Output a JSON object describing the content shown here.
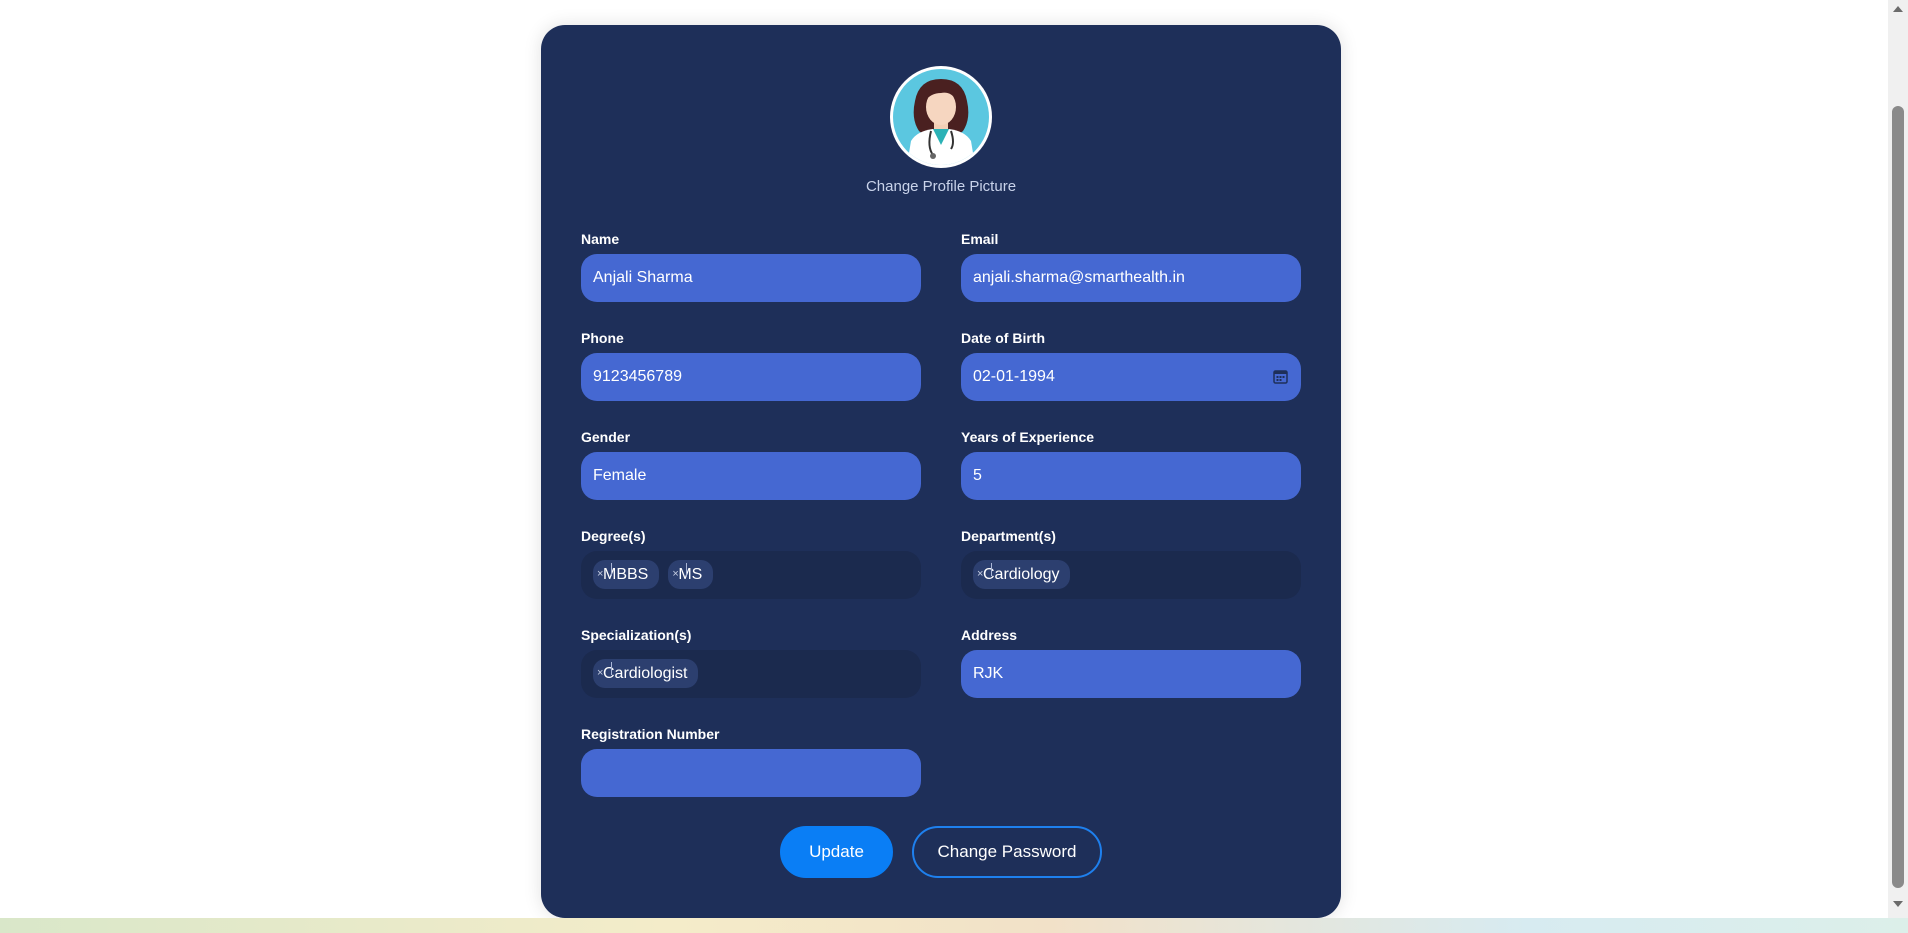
{
  "profile": {
    "change_picture_label": "Change Profile Picture"
  },
  "fields": {
    "name": {
      "label": "Name",
      "value": "Anjali Sharma"
    },
    "email": {
      "label": "Email",
      "value": "anjali.sharma@smarthealth.in"
    },
    "phone": {
      "label": "Phone",
      "value": "9123456789"
    },
    "dob": {
      "label": "Date of Birth",
      "value": "02-01-1994"
    },
    "gender": {
      "label": "Gender",
      "value": "Female"
    },
    "experience": {
      "label": "Years of Experience",
      "value": "5"
    },
    "degrees": {
      "label": "Degree(s)",
      "chips": [
        "MBBS",
        "MS"
      ]
    },
    "departments": {
      "label": "Department(s)",
      "chips": [
        "Cardiology"
      ]
    },
    "specializations": {
      "label": "Specialization(s)",
      "chips": [
        "Cardiologist"
      ]
    },
    "address": {
      "label": "Address",
      "value": "RJK"
    },
    "registration": {
      "label": "Registration Number",
      "value": ""
    }
  },
  "chip_remove_glyph": "×",
  "buttons": {
    "update": "Update",
    "change_password": "Change Password"
  },
  "colors": {
    "card_bg": "#1e2f59",
    "input_bg": "#4568d2",
    "multiselect_bg": "#1b2a4e",
    "chip_bg": "#2c3f6f",
    "primary": "#0a7ef5"
  },
  "icons": {
    "avatar": "doctor-avatar-icon",
    "calendar": "calendar-icon"
  }
}
